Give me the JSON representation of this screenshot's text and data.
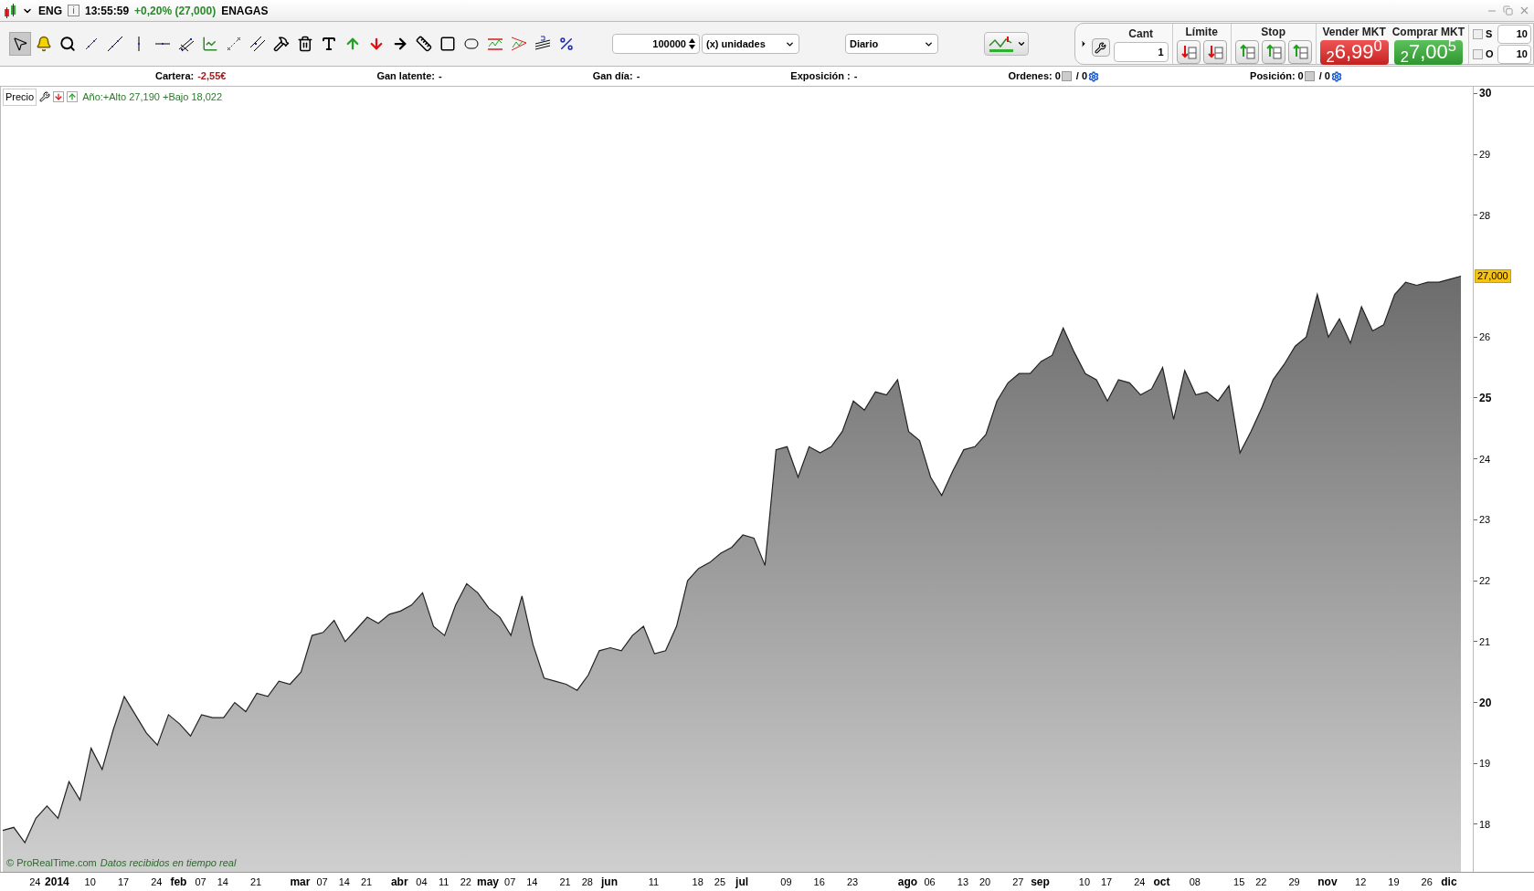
{
  "title_bar": {
    "symbol": "ENG",
    "info_button": "i",
    "time": "13:55:59",
    "change": "+0,20% (27,000)",
    "name": "ENAGAS"
  },
  "toolbar": {
    "tools": [
      {
        "kind": "pointer",
        "selected": true
      },
      {
        "kind": "bell",
        "selected": false
      },
      {
        "kind": "zoom",
        "selected": false
      },
      {
        "kind": "segment",
        "selected": false
      },
      {
        "kind": "line",
        "selected": false
      },
      {
        "kind": "vline",
        "selected": false
      },
      {
        "kind": "hline",
        "selected": false
      },
      {
        "kind": "fan",
        "selected": false
      },
      {
        "kind": "chart",
        "selected": false
      },
      {
        "kind": "points",
        "selected": false
      },
      {
        "kind": "parallel",
        "selected": false
      },
      {
        "kind": "hammer",
        "selected": false
      },
      {
        "kind": "trash",
        "selected": false
      },
      {
        "kind": "text",
        "selected": false
      },
      {
        "kind": "up",
        "selected": false
      },
      {
        "kind": "down",
        "selected": false
      },
      {
        "kind": "right",
        "selected": false
      },
      {
        "kind": "ruler",
        "selected": false
      },
      {
        "kind": "rect",
        "selected": false
      },
      {
        "kind": "ellipse",
        "selected": false
      },
      {
        "kind": "channel",
        "selected": false
      },
      {
        "kind": "triangle",
        "selected": false
      },
      {
        "kind": "fibo",
        "selected": false
      },
      {
        "kind": "percent",
        "selected": false
      }
    ],
    "quantity": "100000",
    "unit": "(x) unidades",
    "period": "Diario"
  },
  "order_panel": {
    "cant_label": "Cant",
    "cant_value": "1",
    "limit_label": "Límite",
    "stop_label": "Stop",
    "sell_label": "Vender MKT",
    "sell_price": "$_{2}$6,99$^{0}$",
    "buy_label": "Comprar MKT",
    "buy_price": "$_{2}$7,00$^{5}$",
    "options": [
      {
        "label": "S",
        "checked": false,
        "value": "10"
      },
      {
        "label": "O",
        "checked": false,
        "value": "10"
      }
    ]
  },
  "info_bar": {
    "cartera_label": "Cartera:",
    "cartera_value": "-2,55€",
    "latent_label": "Gan latente:",
    "latent_value": "-",
    "day_label": "Gan día:",
    "day_value": "-",
    "exposure_label": "Exposición :",
    "exposure_value": "-",
    "orders_label": "Ordenes:",
    "orders_a": "0",
    "orders_sep": "/ 0",
    "position_label": "Posición:",
    "position_a": "0",
    "position_sep": "/ 0"
  },
  "legend": {
    "label": "Precio",
    "stats": "Año:+Alto 27,190 +Bajo 18,022"
  },
  "footer": {
    "copyright": "© ProRealTime.com",
    "status": "Datos recibidos en tiempo real"
  },
  "x_axis_marks": [
    {
      "bold": false
    },
    {
      "bold": true
    },
    {
      "bold": false
    },
    {
      "bold": false
    },
    {
      "bold": false
    },
    {
      "bold": true
    },
    {
      "bold": false
    },
    {
      "bold": false
    },
    {
      "bold": false
    },
    {
      "bold": true
    },
    {
      "bold": false
    },
    {
      "bold": false
    },
    {
      "bold": false
    },
    {
      "bold": true
    },
    {
      "bold": false
    },
    {
      "bold": false
    },
    {
      "bold": false
    },
    {
      "bold": true
    },
    {
      "bold": false
    },
    {
      "bold": false
    },
    {
      "bold": false
    },
    {
      "bold": false
    },
    {
      "bold": true
    },
    {
      "bold": false
    },
    {
      "bold": false
    },
    {
      "bold": false
    },
    {
      "bold": true
    },
    {
      "bold": false
    },
    {
      "bold": false
    },
    {
      "bold": false
    },
    {
      "bold": true
    },
    {
      "bold": false
    },
    {
      "bold": false
    },
    {
      "bold": false
    },
    {
      "bold": false
    },
    {
      "bold": true
    },
    {
      "bold": false
    },
    {
      "bold": false
    },
    {
      "bold": false
    },
    {
      "bold": true
    },
    {
      "bold": false
    },
    {
      "bold": false
    },
    {
      "bold": false
    },
    {
      "bold": false
    },
    {
      "bold": true
    },
    {
      "bold": false
    },
    {
      "bold": false
    },
    {
      "bold": false
    },
    {
      "bold": true
    }
  ],
  "chart_data": {
    "type": "area",
    "ylim": [
      17.22,
      30.11
    ],
    "categories": [
      null,
      null,
      null,
      "24",
      null,
      "2014",
      null,
      null,
      "10",
      null,
      null,
      "17",
      null,
      null,
      "24",
      null,
      "feb",
      null,
      "07",
      null,
      "14",
      null,
      null,
      "21",
      null,
      null,
      null,
      "mar",
      null,
      "07",
      null,
      "14",
      null,
      "21",
      null,
      null,
      "abr",
      null,
      "04",
      null,
      "11",
      null,
      "22",
      null,
      "may",
      null,
      "07",
      null,
      "14",
      null,
      null,
      "21",
      null,
      "28",
      null,
      "jun",
      null,
      null,
      null,
      "11",
      null,
      null,
      null,
      "18",
      null,
      "25",
      null,
      "jul",
      null,
      null,
      null,
      "09",
      null,
      null,
      "16",
      null,
      null,
      "23",
      null,
      null,
      null,
      null,
      "ago",
      null,
      "06",
      null,
      null,
      "13",
      null,
      "20",
      null,
      null,
      "27",
      null,
      "sep",
      null,
      null,
      null,
      "10",
      null,
      "17",
      null,
      null,
      "24",
      null,
      "oct",
      null,
      null,
      "08",
      null,
      null,
      null,
      "15",
      null,
      "22",
      null,
      null,
      "29",
      null,
      null,
      "nov",
      null,
      null,
      "12",
      null,
      null,
      "19",
      null,
      null,
      "26",
      null,
      "dic",
      null
    ],
    "series": [
      {
        "color": "#222222",
        "values": [
          17.9,
          17.95,
          17.7,
          18.1,
          18.3,
          18.1,
          18.7,
          18.4,
          19.25,
          18.9,
          19.55,
          20.1,
          19.8,
          19.5,
          19.3,
          19.8,
          19.65,
          19.45,
          19.8,
          19.75,
          19.75,
          20,
          19.85,
          20.15,
          20.1,
          20.35,
          20.3,
          20.5,
          21.1,
          21.15,
          21.35,
          21,
          21.2,
          21.4,
          21.3,
          21.45,
          21.5,
          21.6,
          21.8,
          21.25,
          21.1,
          21.6,
          21.95,
          21.8,
          21.55,
          21.4,
          21.1,
          21.75,
          20.95,
          20.4,
          20.35,
          20.3,
          20.2,
          20.45,
          20.85,
          20.9,
          20.85,
          21.1,
          21.25,
          20.8,
          20.85,
          21.25,
          22,
          22.2,
          22.3,
          22.45,
          22.55,
          22.75,
          22.7,
          22.25,
          24.15,
          24.2,
          23.7,
          24.2,
          24.1,
          24.2,
          24.45,
          24.95,
          24.8,
          25.1,
          25.05,
          25.3,
          24.45,
          24.3,
          23.7,
          23.4,
          23.8,
          24.15,
          24.2,
          24.4,
          24.95,
          25.25,
          25.4,
          25.4,
          25.6,
          25.7,
          26.15,
          25.75,
          25.4,
          25.3,
          24.95,
          25.3,
          25.25,
          25.05,
          25.15,
          25.5,
          24.65,
          25.45,
          25.05,
          25.1,
          24.95,
          25.2,
          24.1,
          24.45,
          24.85,
          25.3,
          25.55,
          25.85,
          26,
          26.7,
          26,
          26.3,
          25.9,
          26.5,
          26.1,
          26.2,
          26.7,
          26.9,
          26.85,
          26.9,
          26.9,
          26.95,
          27
        ]
      }
    ],
    "yticks": [
      30,
      29,
      28,
      26,
      25,
      24,
      23,
      22,
      21,
      20,
      19,
      18
    ]
  },
  "last_price_label": "27,000"
}
